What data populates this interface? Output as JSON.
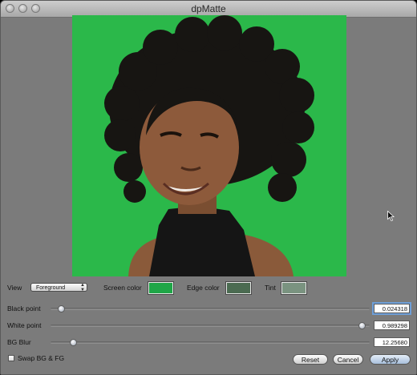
{
  "window": {
    "title": "dpMatte"
  },
  "controls": {
    "view_label": "View",
    "view_value": "Foreground",
    "screen_color_label": "Screen color",
    "edge_color_label": "Edge color",
    "tint_label": "Tint",
    "colors": {
      "screen": "#1fa647",
      "edge": "#4b6b51",
      "tint": "#7a9380"
    }
  },
  "sliders": [
    {
      "label": "Black point",
      "value": "0.024318",
      "position": 0.03
    },
    {
      "label": "White point",
      "value": "0.989298",
      "position": 0.96
    },
    {
      "label": "BG Blur",
      "value": "12.25680",
      "position": 0.07
    }
  ],
  "options": {
    "swap_label": "Swap BG & FG"
  },
  "buttons": {
    "reset": "Reset",
    "cancel": "Cancel",
    "apply": "Apply"
  }
}
